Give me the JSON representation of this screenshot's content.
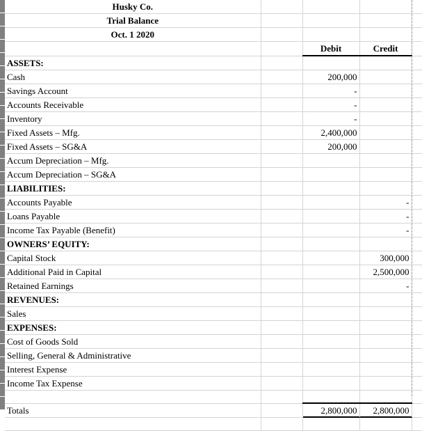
{
  "document": {
    "company": "Husky Co.",
    "statement": "Trial Balance",
    "date": "Oct. 1 2020"
  },
  "columns": {
    "label": "",
    "spacer": "",
    "debit": "Debit",
    "credit": "Credit"
  },
  "rows": [
    {
      "label": "ASSETS:",
      "bold": true,
      "debit": "",
      "credit": ""
    },
    {
      "label": "Cash",
      "bold": false,
      "debit": "200,000",
      "credit": ""
    },
    {
      "label": "Savings Account",
      "bold": false,
      "debit": "-",
      "credit": ""
    },
    {
      "label": "Accounts Receivable",
      "bold": false,
      "debit": "-",
      "credit": ""
    },
    {
      "label": "Inventory",
      "bold": false,
      "debit": "-",
      "credit": ""
    },
    {
      "label": "Fixed Assets – Mfg.",
      "bold": false,
      "debit": "2,400,000",
      "credit": ""
    },
    {
      "label": "Fixed Assets – SG&A",
      "bold": false,
      "debit": "200,000",
      "credit": ""
    },
    {
      "label": "Accum Depreciation – Mfg.",
      "bold": false,
      "debit": "",
      "credit": ""
    },
    {
      "label": "Accum Depreciation – SG&A",
      "bold": false,
      "debit": "",
      "credit": ""
    },
    {
      "label": "LIABILITIES:",
      "bold": true,
      "debit": "",
      "credit": ""
    },
    {
      "label": "Accounts Payable",
      "bold": false,
      "debit": "",
      "credit": "-"
    },
    {
      "label": "Loans Payable",
      "bold": false,
      "debit": "",
      "credit": "-"
    },
    {
      "label": "Income Tax Payable (Benefit)",
      "bold": false,
      "debit": "",
      "credit": "-"
    },
    {
      "label": "OWNERS’ EQUITY:",
      "bold": true,
      "debit": "",
      "credit": ""
    },
    {
      "label": "Capital Stock",
      "bold": false,
      "debit": "",
      "credit": "300,000"
    },
    {
      "label": "Additional Paid in Capital",
      "bold": false,
      "debit": "",
      "credit": "2,500,000"
    },
    {
      "label": "Retained Earnings",
      "bold": false,
      "debit": "",
      "credit": "-"
    },
    {
      "label": "REVENUES:",
      "bold": true,
      "debit": "",
      "credit": ""
    },
    {
      "label": "Sales",
      "bold": false,
      "debit": "",
      "credit": ""
    },
    {
      "label": "EXPENSES:",
      "bold": true,
      "debit": "",
      "credit": ""
    },
    {
      "label": "Cost of Goods Sold",
      "bold": false,
      "debit": "",
      "credit": ""
    },
    {
      "label": "Selling, General & Administrative",
      "bold": false,
      "debit": "",
      "credit": ""
    },
    {
      "label": "Interest Expense",
      "bold": false,
      "debit": "",
      "credit": ""
    },
    {
      "label": "Income Tax Expense",
      "bold": false,
      "debit": "",
      "credit": ""
    },
    {
      "label": "",
      "bold": false,
      "debit": "",
      "credit": ""
    }
  ],
  "totals": {
    "label": "Totals",
    "debit": "2,800,000",
    "credit": "2,800,000"
  },
  "colors": {
    "gridline": "#d4d4d4",
    "gutter": "#808080",
    "rule": "#000000",
    "pagebreak": "#9a9a9a"
  }
}
